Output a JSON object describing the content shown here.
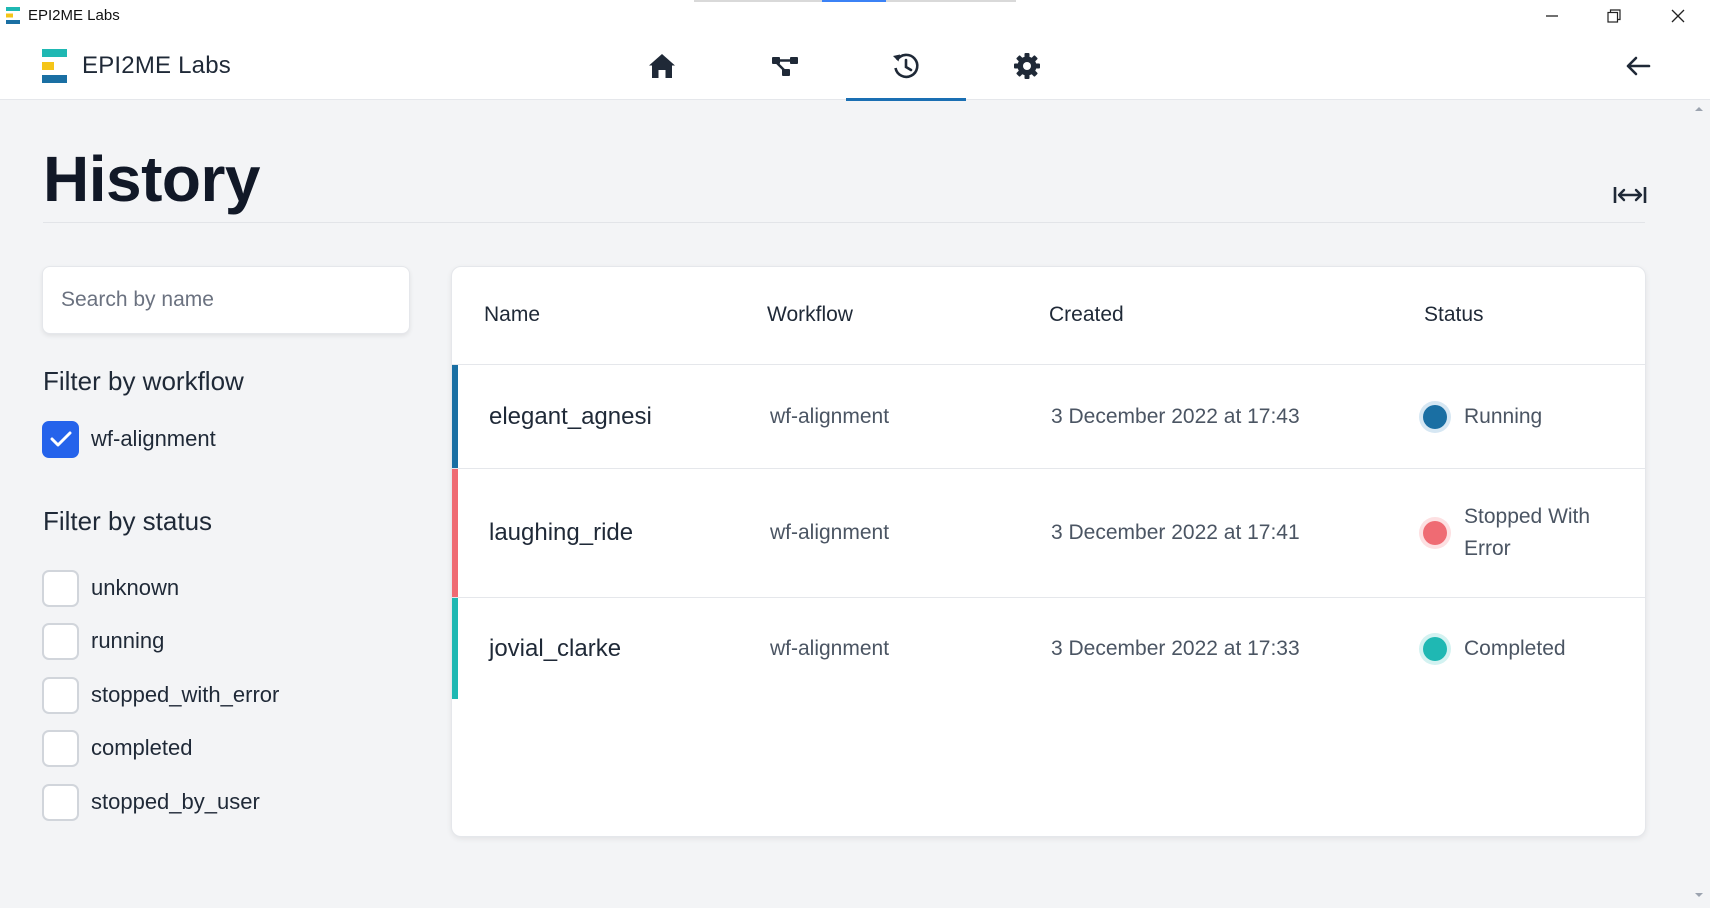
{
  "window": {
    "title": "EPI2ME Labs",
    "controls": [
      "minimize-icon",
      "restore-icon",
      "close-icon"
    ]
  },
  "header": {
    "brand": "EPI2ME Labs",
    "nav": [
      {
        "id": "home",
        "icon": "home-icon",
        "active": false
      },
      {
        "id": "workflows",
        "icon": "workflow-icon",
        "active": false
      },
      {
        "id": "history",
        "icon": "history-icon",
        "active": true
      },
      {
        "id": "settings",
        "icon": "gear-icon",
        "active": false
      }
    ],
    "back_icon": "arrow-left-icon"
  },
  "page": {
    "title": "History",
    "expand_icon": "expand-width-icon"
  },
  "sidebar": {
    "search": {
      "placeholder": "Search by name",
      "value": ""
    },
    "workflow_filter": {
      "heading": "Filter by workflow",
      "options": [
        {
          "label": "wf-alignment",
          "checked": true
        }
      ]
    },
    "status_filter": {
      "heading": "Filter by status",
      "options": [
        {
          "label": "unknown",
          "checked": false
        },
        {
          "label": "running",
          "checked": false
        },
        {
          "label": "stopped_with_error",
          "checked": false
        },
        {
          "label": "completed",
          "checked": false
        },
        {
          "label": "stopped_by_user",
          "checked": false
        }
      ]
    }
  },
  "table": {
    "columns": [
      "Name",
      "Workflow",
      "Created",
      "Status"
    ],
    "rows": [
      {
        "name": "elegant_agnesi",
        "workflow": "wf-alignment",
        "created": "3 December 2022 at 17:43",
        "status": "Running",
        "status_color": "#1a6fa3"
      },
      {
        "name": "laughing_ride",
        "workflow": "wf-alignment",
        "created": "3 December 2022 at 17:41",
        "status": "Stopped With Error",
        "status_color": "#ef6b73"
      },
      {
        "name": "jovial_clarke",
        "workflow": "wf-alignment",
        "created": "3 December 2022 at 17:33",
        "status": "Completed",
        "status_color": "#1fb8b3"
      }
    ]
  },
  "colors": {
    "accent": "#1a6fb3",
    "checkbox_checked": "#2563eb",
    "logo_teal": "#1fb8b3",
    "logo_yellow": "#f5c518",
    "logo_blue": "#1a6fa3"
  }
}
